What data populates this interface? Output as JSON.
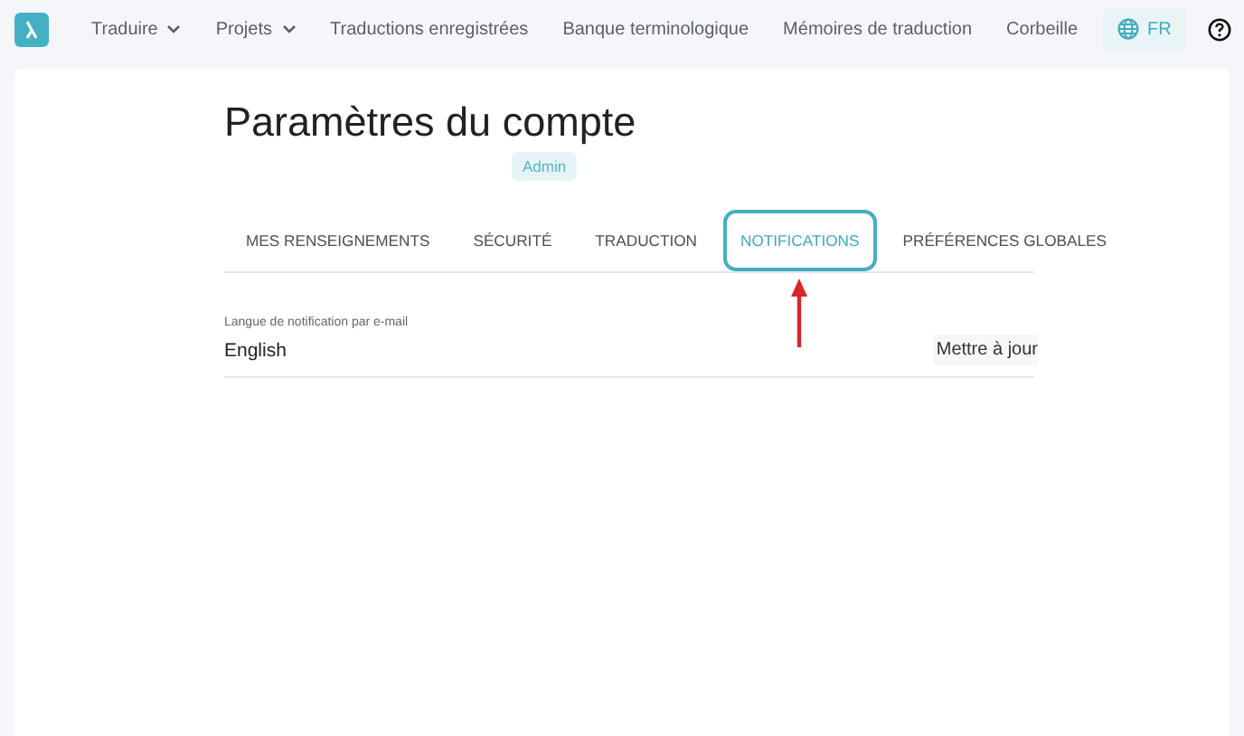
{
  "nav": {
    "items": [
      {
        "label": "Traduire",
        "dropdown": true
      },
      {
        "label": "Projets",
        "dropdown": true
      },
      {
        "label": "Traductions enregistrées",
        "dropdown": false
      },
      {
        "label": "Banque terminologique",
        "dropdown": false
      },
      {
        "label": "Mémoires de traduction",
        "dropdown": false
      },
      {
        "label": "Corbeille",
        "dropdown": false
      }
    ],
    "language": "FR"
  },
  "page": {
    "title": "Paramètres du compte",
    "role_badge": "Admin"
  },
  "tabs": [
    {
      "label": "MES RENSEIGNEMENTS",
      "selected": false,
      "highlighted": false
    },
    {
      "label": "SÉCURITÉ",
      "selected": false,
      "highlighted": false
    },
    {
      "label": "TRADUCTION",
      "selected": false,
      "highlighted": false
    },
    {
      "label": "NOTIFICATIONS",
      "selected": true,
      "highlighted": true
    },
    {
      "label": "PRÉFÉRENCES GLOBALES",
      "selected": false,
      "highlighted": false
    }
  ],
  "notification_language": {
    "label": "Langue de notification par e-mail",
    "value": "English",
    "button": "Mettre à jour"
  }
}
